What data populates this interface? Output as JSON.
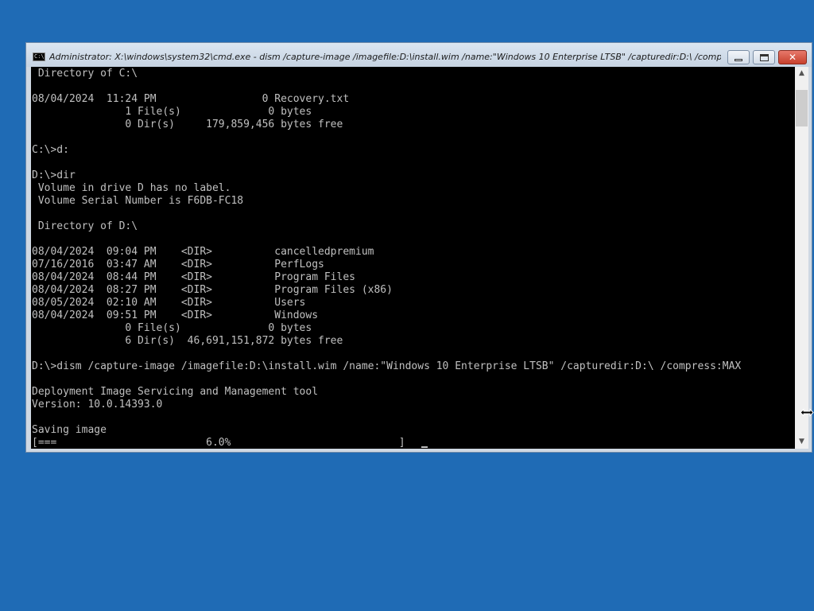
{
  "window": {
    "title": "Administrator: X:\\windows\\system32\\cmd.exe - dism  /capture-image /imagefile:D:\\install.wim /name:\"Windows 10 Enterprise LTSB\" /capturedir:D:\\ /compress:...",
    "icon_text": "C:\\",
    "close_glyph": "✕"
  },
  "console": {
    "lines": [
      " Directory of C:\\",
      "",
      "08/04/2024  11:24 PM                 0 Recovery.txt",
      "               1 File(s)              0 bytes",
      "               0 Dir(s)     179,859,456 bytes free",
      "",
      "C:\\>d:",
      "",
      "D:\\>dir",
      " Volume in drive D has no label.",
      " Volume Serial Number is F6DB-FC18",
      "",
      " Directory of D:\\",
      "",
      "08/04/2024  09:04 PM    <DIR>          cancelledpremium",
      "07/16/2016  03:47 AM    <DIR>          PerfLogs",
      "08/04/2024  08:44 PM    <DIR>          Program Files",
      "08/04/2024  08:27 PM    <DIR>          Program Files (x86)",
      "08/05/2024  02:10 AM    <DIR>          Users",
      "08/04/2024  09:51 PM    <DIR>          Windows",
      "               0 File(s)              0 bytes",
      "               6 Dir(s)  46,691,151,872 bytes free",
      "",
      "D:\\>dism /capture-image /imagefile:D:\\install.wim /name:\"Windows 10 Enterprise LTSB\" /capturedir:D:\\ /compress:MAX",
      "",
      "Deployment Image Servicing and Management tool",
      "Version: 10.0.14393.0",
      "",
      "Saving image",
      "[===                        6.0%                           ]"
    ]
  },
  "progress": {
    "percent": 6.0
  },
  "scrollbar": {
    "up_arrow": "▲",
    "down_arrow": "▼"
  },
  "colors": {
    "desktop": "#1f6bb5",
    "console_background": "#000000",
    "console_text": "#c0c0c0"
  }
}
